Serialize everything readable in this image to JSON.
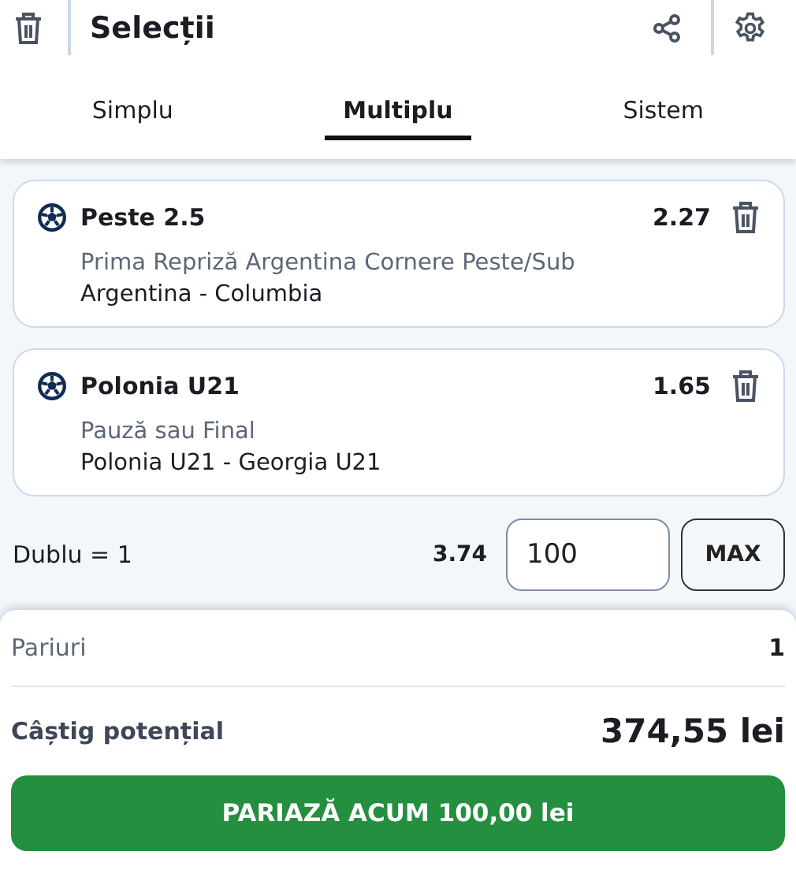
{
  "header": {
    "title": "Selecții"
  },
  "tabs": [
    {
      "label": "Simplu",
      "selected": false
    },
    {
      "label": "Multiplu",
      "selected": true
    },
    {
      "label": "Sistem",
      "selected": false
    }
  ],
  "selections": [
    {
      "market": "Peste 2.5",
      "odds": "2.27",
      "description": "Prima Repriză Argentina Cornere Peste/Sub",
      "event": "Argentina - Columbia"
    },
    {
      "market": "Polonia U21",
      "odds": "1.65",
      "description": "Pauză sau Final",
      "event": "Polonia U21 - Georgia U21"
    }
  ],
  "stake_row": {
    "label": "Dublu = 1",
    "odds": "3.74",
    "stake": "100",
    "max_button": "MAX"
  },
  "summary": {
    "bets_label": "Pariuri",
    "bets_value": "1",
    "win_label": "Câștig potențial",
    "win_value": "374,55 lei"
  },
  "place_button": "PARIAZĂ ACUM 100,00 lei"
}
